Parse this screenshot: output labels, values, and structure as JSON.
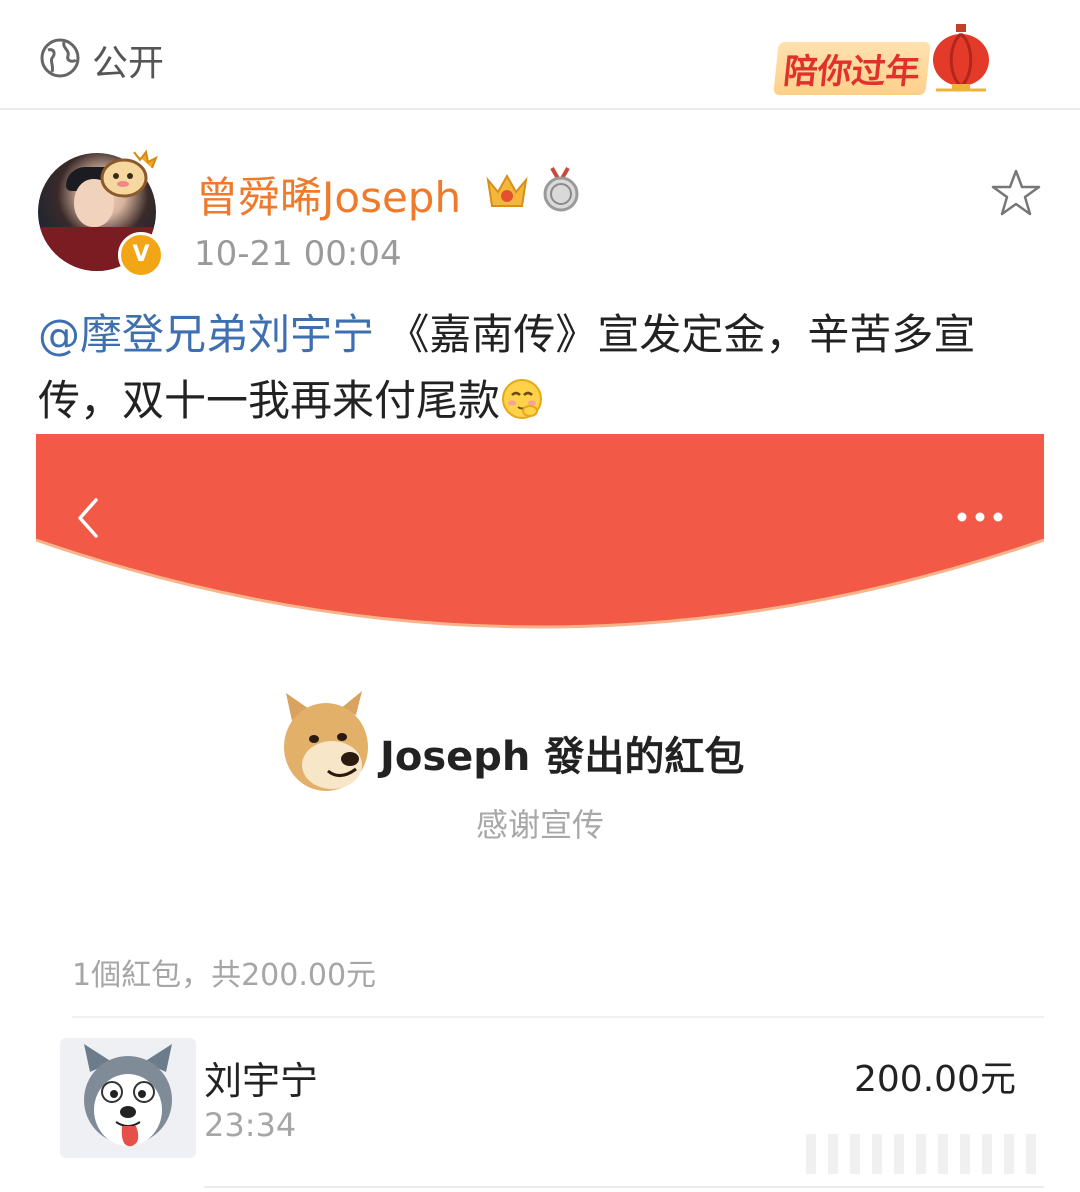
{
  "topbar": {
    "visibility_label": "公开",
    "visibility_icon": "globe-icon",
    "festival_text": "陪你过年"
  },
  "post": {
    "username": "曾舜晞Joseph",
    "timestamp": "10-21 00:04",
    "mention": "@摩登兄弟刘宇宁",
    "text": " 《嘉南传》宣发定金，辛苦多宣传，双十一我再来付尾款"
  },
  "red_packet": {
    "sender_title": "Joseph 發出的紅包",
    "greeting": "感谢宣传",
    "summary": "1個紅包，共200.00元",
    "receiver": {
      "name": "刘宇宁",
      "time": "23:34",
      "amount": "200.00元"
    }
  },
  "colors": {
    "brand_orange": "#f07a2a",
    "mention_blue": "#3e6fb0",
    "packet_red": "#f25a47"
  }
}
